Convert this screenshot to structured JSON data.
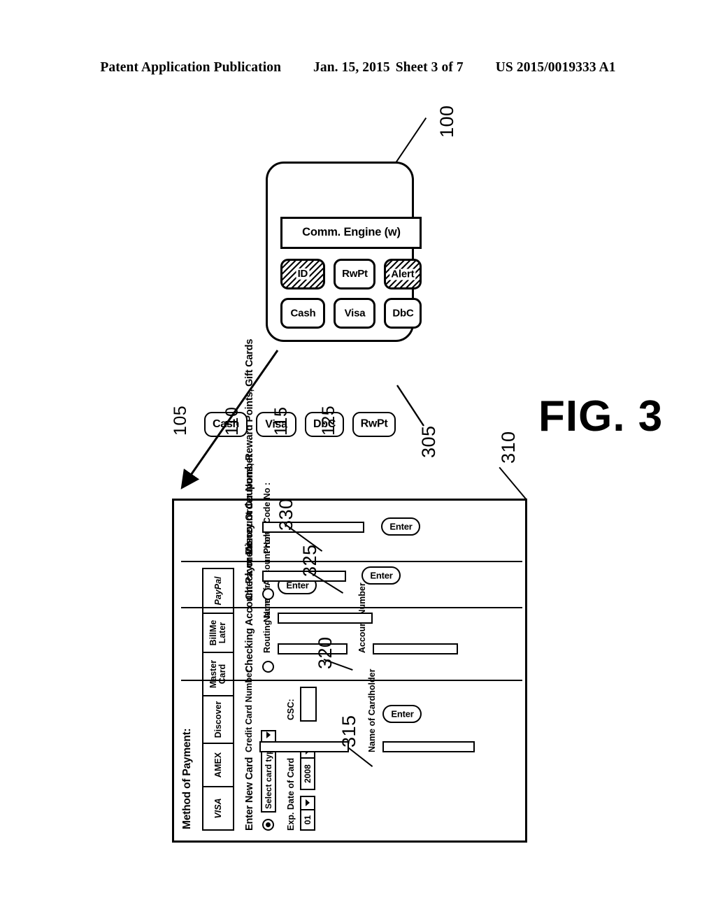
{
  "header": {
    "publication": "Patent Application Publication",
    "date": "Jan. 15, 2015",
    "sheet": "Sheet 3 of 7",
    "patent_number": "US 2015/0019333 A1"
  },
  "figure": {
    "caption": "FIG. 3"
  },
  "form": {
    "ref": "310",
    "title": "Method of Payment:",
    "card_tabs": [
      {
        "label": "VISA",
        "style": "italic"
      },
      {
        "label": "AMEX",
        "style": "normal"
      },
      {
        "label": "Discover",
        "style": "normal"
      },
      {
        "label": "Master\nCard",
        "style": "normal"
      },
      {
        "label": "BillMe\nLater",
        "style": "normal"
      },
      {
        "label": "PayPal",
        "style": "italic"
      }
    ],
    "sections": {
      "new_card": {
        "ref": "315",
        "heading": "Enter New Card",
        "radio_selected": true,
        "card_type_select": {
          "value": "Select card type",
          "icon": "chevron-down-icon"
        },
        "exp_label": "Exp. Date of Card",
        "exp_month": "01",
        "exp_year": "2008",
        "csc_label": "CSC:",
        "csc_value": "",
        "card_number_label": "Credit Card Number",
        "card_number_value": "",
        "cardholder_label": "Name of Cardholder",
        "cardholder_value": "",
        "enter_label": "Enter"
      },
      "checking": {
        "ref": "320",
        "heading": "Checking Account Payment",
        "radio_selected": false,
        "routing_label": "Routing  Number",
        "routing_value": "",
        "account_label": "Account  Number",
        "account_value": "",
        "holder_label": "Name of Account Holder",
        "holder_value": "",
        "enter_label": "Enter"
      },
      "check_money_order": {
        "ref": "325",
        "heading": "Check or Money Order Number",
        "radio_selected": false,
        "number_value": "",
        "enter_label": "Enter"
      },
      "discounts": {
        "ref": "330",
        "heading": "Discount Coupons, Reward Points, Gift Cards",
        "promo_label": "Promo Code  No :",
        "promo_value": "",
        "enter_label": "Enter"
      }
    }
  },
  "device": {
    "ref": "100",
    "comm_engine": "Comm. Engine (w)",
    "chips": [
      {
        "label": "Cash",
        "hatched": false
      },
      {
        "label": "Visa",
        "hatched": false
      },
      {
        "label": "DbC",
        "hatched": false
      },
      {
        "label": "ID",
        "hatched": true
      },
      {
        "label": "RwPt",
        "hatched": false
      },
      {
        "label": "Alert",
        "hatched": true
      }
    ]
  },
  "legend": {
    "arrow_ref": "305",
    "items": [
      {
        "label": "Cash",
        "ref": "105"
      },
      {
        "label": "Visa",
        "ref": "110"
      },
      {
        "label": "DbC",
        "ref": "115"
      },
      {
        "label": "RwPt",
        "ref": "125"
      }
    ]
  }
}
